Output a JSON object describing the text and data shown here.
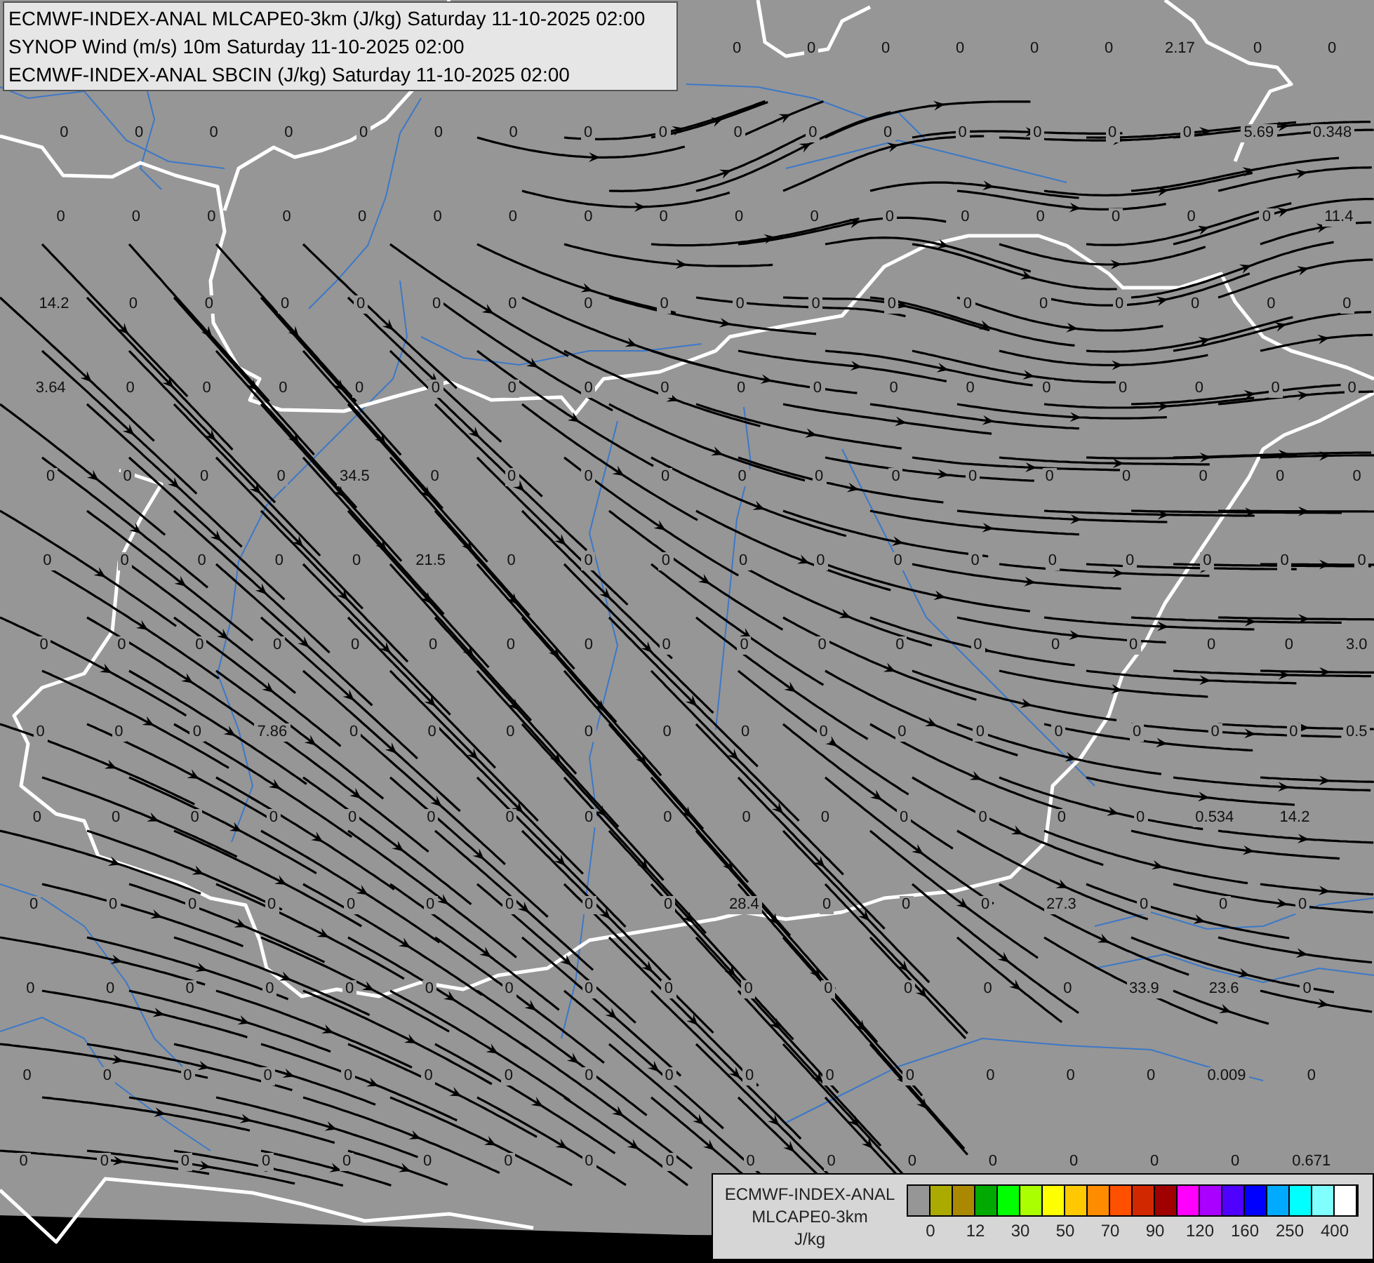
{
  "header": {
    "lines": [
      "ECMWF-INDEX-ANAL MLCAPE0-3km (J/kg) Saturday 11-10-2025 02:00",
      "SYNOP Wind (m/s) 10m Saturday 11-10-2025 02:00",
      "ECMWF-INDEX-ANAL SBCIN (J/kg) Saturday 11-10-2025 02:00"
    ]
  },
  "station_values": {
    "rows": [
      [
        null,
        null,
        null,
        null,
        null,
        null,
        null,
        null,
        null,
        "0",
        "0",
        "0",
        "0",
        "0",
        "0",
        "2.17",
        "0",
        "0"
      ],
      [
        "0",
        "0",
        "0",
        "0",
        "0",
        "0",
        "0",
        "0",
        "0",
        "0",
        "0",
        "0",
        "0",
        "0",
        "0",
        "0",
        "5.69",
        "0.348"
      ],
      [
        "0",
        "0",
        "0",
        "0",
        "0",
        "0",
        "0",
        "0",
        "0",
        "0",
        "0",
        "0",
        "0",
        "0",
        "0",
        "0",
        "0",
        "11.4"
      ],
      [
        "14.2",
        "0",
        "0",
        "0",
        "0",
        "0",
        "0",
        "0",
        "0",
        "0",
        "0",
        "0",
        "0",
        "0",
        "0",
        "0",
        "0",
        "0"
      ],
      [
        "3.64",
        "0",
        "0",
        "0",
        "0",
        "0",
        "0",
        "0",
        "0",
        "0",
        "0",
        "0",
        "0",
        "0",
        "0",
        "0",
        "0",
        "0"
      ],
      [
        "0",
        "0",
        "0",
        "0",
        "34.5",
        "0",
        "0",
        "0",
        "0",
        "0",
        "0",
        "0",
        "0",
        "0",
        "0",
        "0",
        "0",
        "0"
      ],
      [
        "0",
        "0",
        "0",
        "0",
        "0",
        "21.5",
        "0",
        "0",
        "0",
        "0",
        "0",
        "0",
        "0",
        "0",
        "0",
        "0",
        "0",
        "0"
      ],
      [
        "0",
        "0",
        "0",
        "0",
        "0",
        "0",
        "0",
        "0",
        "0",
        "0",
        "0",
        "0",
        "0",
        "0",
        "0",
        "0",
        "0",
        "3.0"
      ],
      [
        "0",
        "0",
        "0",
        "7.86",
        "0",
        "0",
        "0",
        "0",
        "0",
        "0",
        "0",
        "0",
        "0",
        "0",
        "0",
        "0",
        "0",
        "0.5"
      ],
      [
        "0",
        "0",
        "0",
        "0",
        "0",
        "0",
        "0",
        "0",
        "0",
        "0",
        "0",
        "0",
        "0",
        "0",
        "0",
        "0.534",
        "14.2",
        null
      ],
      [
        "0",
        "0",
        "0",
        "0",
        "0",
        "0",
        "0",
        "0",
        "0",
        "28.4",
        "0",
        "0",
        "0",
        "27.3",
        "0",
        "0",
        "0",
        null
      ],
      [
        "0",
        "0",
        "0",
        "0",
        "0",
        "0",
        "0",
        "0",
        "0",
        "0",
        "0",
        "0",
        "0",
        "0",
        "33.9",
        "23.6",
        "0",
        null
      ],
      [
        "0",
        "0",
        "0",
        "0",
        "0",
        "0",
        "0",
        "0",
        "0",
        "0",
        "0",
        "0",
        "0",
        "0",
        "0",
        "0.009",
        "0",
        null
      ],
      [
        "0",
        "0",
        "0",
        "0",
        "0",
        "0",
        "0",
        "0",
        "0",
        "0",
        "0",
        "0",
        "0",
        "0",
        "0",
        "0",
        "0.671",
        null
      ]
    ]
  },
  "legend": {
    "title": "ECMWF-INDEX-ANAL",
    "field": "MLCAPE0-3km",
    "unit": "J/kg",
    "swatches": [
      {
        "color": "#969696"
      },
      {
        "color": "#aaaa00"
      },
      {
        "color": "#aa8800"
      },
      {
        "color": "#00aa00"
      },
      {
        "color": "#00ff00"
      },
      {
        "color": "#aaff00"
      },
      {
        "color": "#ffff00"
      },
      {
        "color": "#ffc800"
      },
      {
        "color": "#ff8c00"
      },
      {
        "color": "#ff5000"
      },
      {
        "color": "#d22800"
      },
      {
        "color": "#a00000"
      },
      {
        "color": "#ff00ff"
      },
      {
        "color": "#aa00ff"
      },
      {
        "color": "#5000ff"
      },
      {
        "color": "#0000ff"
      },
      {
        "color": "#00aaff"
      },
      {
        "color": "#00ffff"
      },
      {
        "color": "#80ffff"
      },
      {
        "color": "#ffffff"
      }
    ],
    "ticks": [
      "0",
      "12",
      "30",
      "50",
      "70",
      "90",
      "120",
      "160",
      "250",
      "400"
    ]
  }
}
